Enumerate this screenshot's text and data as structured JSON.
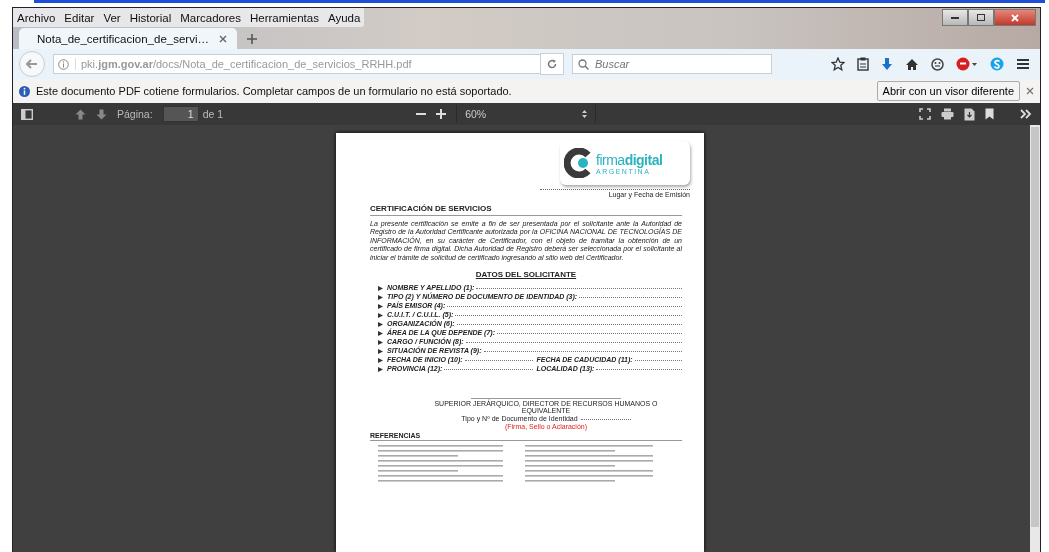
{
  "menu": [
    "Archivo",
    "Editar",
    "Ver",
    "Historial",
    "Marcadores",
    "Herramientas",
    "Ayuda"
  ],
  "tabs": [
    {
      "label": "Nota_de_certificacion_de_servi…",
      "selected": true
    }
  ],
  "address_bar": {
    "url": "pki.**jgm.gov.ar**/docs/Nota_de_certificacion_de_servicios_RRHH.pdf"
  },
  "search": {
    "placeholder": "Buscar"
  },
  "notification": {
    "message": "Este documento PDF cotiene formularios. Completar campos de un formulario no está soportado.",
    "button": "Abrir con un visor diferente"
  },
  "pdf_toolbar": {
    "page_label": "Página:",
    "page": "1",
    "page_count": "de 1",
    "zoom": "60%"
  },
  "document": {
    "logo_text": "firma**digital**",
    "logo_subtitle": "ARGENTINA",
    "place_date_caption": "Lugar y Fecha de Emisión",
    "title": "CERTIFICACIÓN DE SERVICIOS",
    "intro": "La presente certificación se emite a fin de ser presentada por el solicitante ante la Autoridad de Registro de la Autoridad Certificante autorizada por la OFICINA NACIONAL DE TECNOLOGÍAS DE INFORMACIÓN, en su carácter de Certificador, con el objeto de tramitar la obtención de un certificado de firma digital. Dicha Autoridad de Registro deberá ser seleccionada por el solicitante al iniciar el trámite de solicitud de certificado ingresando al sitio web del Certificador.",
    "section_title": "DATOS DEL SOLICITANTE",
    "rows": [
      {
        "fields": [
          "NOMBRE Y APELLIDO (1):"
        ]
      },
      {
        "fields": [
          "TIPO (2) Y NÚMERO DE DOCUMENTO DE IDENTIDAD (3):"
        ]
      },
      {
        "fields": [
          "PAÍS EMISOR (4):"
        ]
      },
      {
        "fields": [
          "C.U.I.T. / C.U.I.L. (5):"
        ]
      },
      {
        "fields": [
          "ORGANIZACIÓN (6):"
        ]
      },
      {
        "fields": [
          "ÁREA DE LA QUE DEPENDE (7):"
        ]
      },
      {
        "fields": [
          "CARGO / FUNCIÓN (8):"
        ]
      },
      {
        "fields": [
          "SITUACIÓN DE REVISTA (9):"
        ]
      },
      {
        "fields": [
          "FECHA DE INICIO (10):",
          "FECHA DE CADUCIDAD (11):"
        ]
      },
      {
        "fields": [
          "PROVINCIA (12):",
          "LOCALIDAD (13):"
        ]
      }
    ],
    "signer": "SUPERIOR JERÁRQUICO, DIRECTOR DE RECURSOS HUMANOS O EQUIVALENTE",
    "signer_id": "Tipo y Nº de Documento de Identidad",
    "signature_note": "(Firma, Sello o Aclaración)",
    "references_title": "REFERENCIAS"
  }
}
